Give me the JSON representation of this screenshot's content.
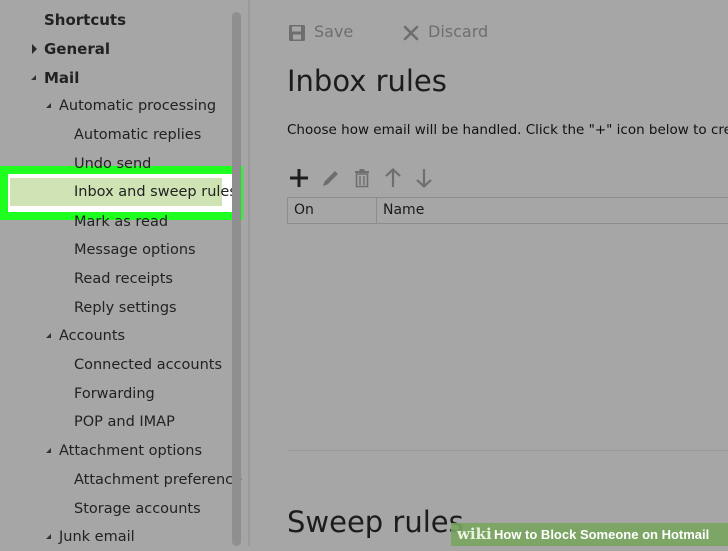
{
  "sidebar": {
    "items": [
      {
        "label": "Shortcuts"
      },
      {
        "label": "General"
      },
      {
        "label": "Mail"
      },
      {
        "label": "Automatic processing"
      },
      {
        "label": "Automatic replies"
      },
      {
        "label": "Undo send"
      },
      {
        "label": "Inbox and sweep rules",
        "selected": true
      },
      {
        "label": "Mark as read"
      },
      {
        "label": "Message options"
      },
      {
        "label": "Read receipts"
      },
      {
        "label": "Reply settings"
      },
      {
        "label": "Accounts"
      },
      {
        "label": "Connected accounts"
      },
      {
        "label": "Forwarding"
      },
      {
        "label": "POP and IMAP"
      },
      {
        "label": "Attachment options"
      },
      {
        "label": "Attachment preference"
      },
      {
        "label": "Storage accounts"
      },
      {
        "label": "Junk email"
      }
    ],
    "highlight_color": "#1fff1f"
  },
  "toolbar": {
    "save_label": "Save",
    "discard_label": "Discard"
  },
  "main": {
    "title": "Inbox rules",
    "description": "Choose how email will be handled. Click the \"+\" icon below to create a new rule.",
    "rule_tools": [
      "add-icon",
      "edit-icon",
      "delete-icon",
      "move-up-icon",
      "move-down-icon"
    ],
    "table": {
      "columns": [
        "On",
        "Name"
      ]
    },
    "sweep_title": "Sweep rules"
  },
  "watermark": {
    "logo": "wiki",
    "text": "How to Block Someone on Hotmail"
  }
}
